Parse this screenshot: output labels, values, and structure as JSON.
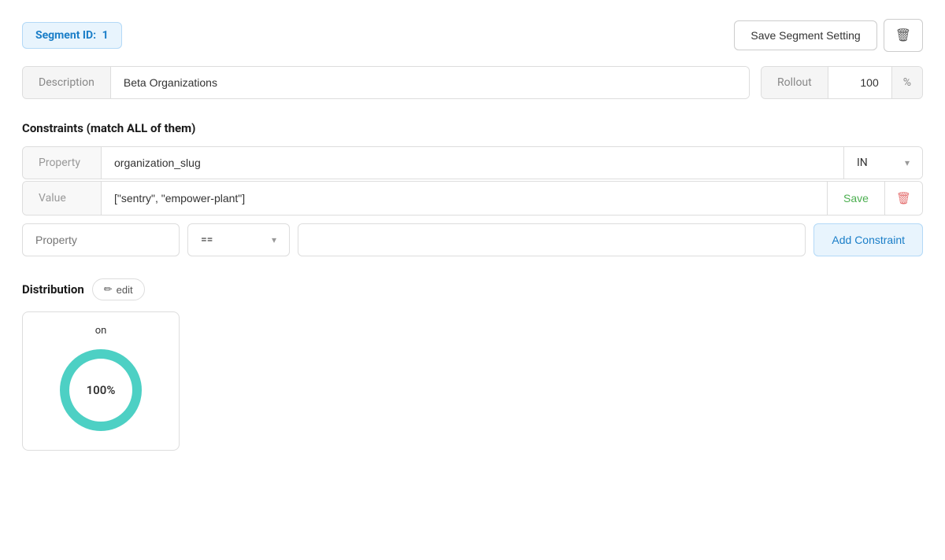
{
  "segment": {
    "id_label": "Segment ID:",
    "id_value": "1",
    "save_button_label": "Save Segment Setting",
    "description_label": "Description",
    "description_value": "Beta Organizations",
    "rollout_label": "Rollout",
    "rollout_value": "100",
    "rollout_unit": "%"
  },
  "constraints": {
    "section_title": "Constraints (match ALL of them)",
    "existing": [
      {
        "property_label": "Property",
        "property_value": "organization_slug",
        "operator": "IN",
        "value_label": "Value",
        "value": "[\"sentry\", \"empower-plant\"]",
        "save_label": "Save"
      }
    ],
    "new_row": {
      "property_placeholder": "Property",
      "operator_value": "==",
      "value_placeholder": "",
      "add_button_label": "Add Constraint"
    }
  },
  "distribution": {
    "title": "Distribution",
    "edit_label": "edit",
    "on_label": "on",
    "percentage": "100%",
    "donut_value": 100,
    "donut_color": "#4dd0c4",
    "donut_bg": "#e8f8f7"
  },
  "icons": {
    "trash": "🗑",
    "pencil": "✏",
    "chevron_down": "▾"
  }
}
